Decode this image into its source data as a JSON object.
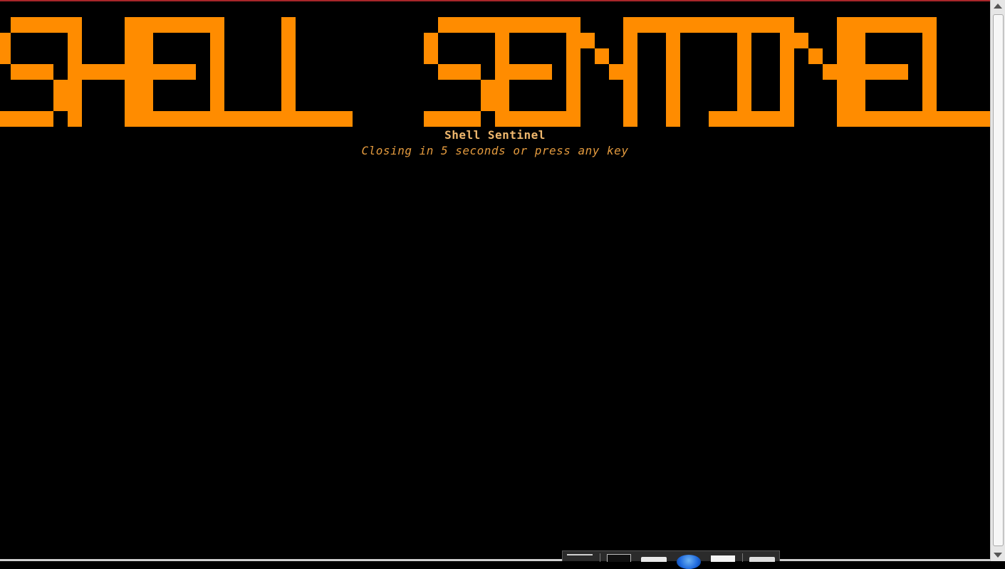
{
  "banner": {
    "ascii_text": "SHELL SENTINEL",
    "color": "#ff8c00"
  },
  "title": "Shell Sentinel",
  "subtitle": "Closing in 5 seconds or press any key",
  "colors": {
    "background": "#000000",
    "title": "#f0b86e",
    "subtitle": "#e39a3e"
  },
  "dock": {
    "items": [
      "window-list-icon",
      "terminal-icon",
      "file-manager-icon",
      "browser-icon",
      "text-editor-icon",
      "folder-icon"
    ]
  }
}
